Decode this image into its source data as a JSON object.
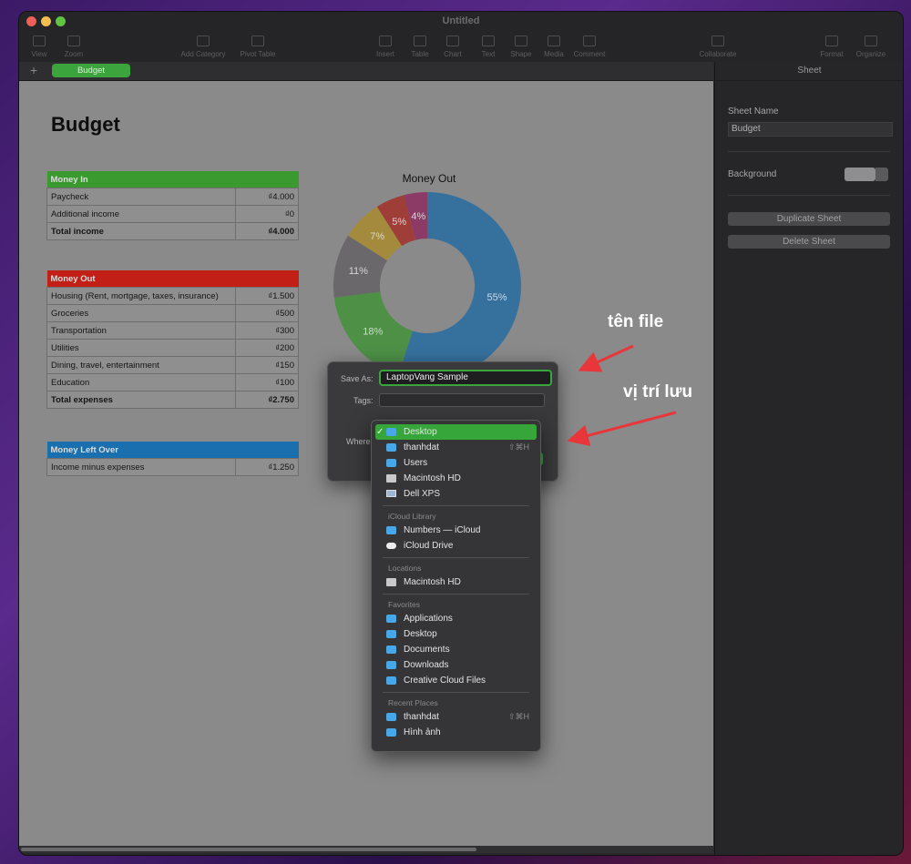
{
  "window": {
    "title": "Untitled",
    "toolbar": [
      "View",
      "Zoom",
      "Add Category",
      "Pivot Table",
      "Insert",
      "Table",
      "Chart",
      "Text",
      "Shape",
      "Media",
      "Comment",
      "Collaborate",
      "Format",
      "Organize"
    ]
  },
  "tabs": {
    "add": "+",
    "active": "Budget"
  },
  "sheet": {
    "title": "Budget"
  },
  "tables": {
    "money_in": {
      "header": "Money In",
      "color": "#3a9a2f",
      "rows": [
        [
          "Paycheck",
          "₫4.000"
        ],
        [
          "Additional income",
          "₫0"
        ]
      ],
      "total": [
        "Total income",
        "₫4.000"
      ]
    },
    "money_out": {
      "header": "Money Out",
      "color": "#c21f16",
      "rows": [
        [
          "Housing (Rent, mortgage, taxes, insurance)",
          "₫1.500"
        ],
        [
          "Groceries",
          "₫500"
        ],
        [
          "Transportation",
          "₫300"
        ],
        [
          "Utilities",
          "₫200"
        ],
        [
          "Dining, travel, entertainment",
          "₫150"
        ],
        [
          "Education",
          "₫100"
        ]
      ],
      "total": [
        "Total expenses",
        "₫2.750"
      ]
    },
    "left_over": {
      "header": "Money Left Over",
      "color": "#1a6fae",
      "rows": [
        [
          "Income minus expenses",
          "₫1.250"
        ]
      ]
    }
  },
  "chart_data": {
    "type": "pie",
    "title": "Money Out",
    "donut": true,
    "labels": [
      "55%",
      "18%",
      "11%",
      "7%",
      "5%",
      "4%"
    ],
    "values": [
      55,
      18,
      11,
      7,
      5,
      4
    ],
    "colors": [
      "#1668a6",
      "#36932c",
      "#5e5b60",
      "#ad8a1e",
      "#a8201a",
      "#8e1d59"
    ]
  },
  "inspector": {
    "title": "Sheet",
    "sheet_name_label": "Sheet Name",
    "sheet_name_value": "Budget",
    "background_label": "Background",
    "duplicate": "Duplicate Sheet",
    "delete": "Delete Sheet"
  },
  "dialog": {
    "save_as_label": "Save As:",
    "save_as_value": "LaptopVang Sample",
    "tags_label": "Tags:",
    "where_label": "Where"
  },
  "menu": {
    "top": [
      {
        "label": "Desktop",
        "icon": "folder-icon",
        "selected": true,
        "check": "✓"
      },
      {
        "label": "thanhdat",
        "icon": "folder-icon",
        "shortcut": "⇧⌘H"
      },
      {
        "label": "Users",
        "icon": "folder-icon"
      },
      {
        "label": "Macintosh HD",
        "icon": "hard-drive-icon"
      },
      {
        "label": "Dell XPS",
        "icon": "laptop-icon"
      }
    ],
    "icloud_header": "iCloud Library",
    "icloud": [
      {
        "label": "Numbers — iCloud",
        "icon": "folder-icon"
      },
      {
        "label": "iCloud Drive",
        "icon": "cloud-icon"
      }
    ],
    "locations_header": "Locations",
    "locations": [
      {
        "label": "Macintosh HD",
        "icon": "hard-drive-icon"
      }
    ],
    "favorites_header": "Favorites",
    "favorites": [
      {
        "label": "Applications",
        "icon": "folder-icon"
      },
      {
        "label": "Desktop",
        "icon": "folder-icon"
      },
      {
        "label": "Documents",
        "icon": "folder-icon"
      },
      {
        "label": "Downloads",
        "icon": "folder-icon"
      },
      {
        "label": "Creative Cloud Files",
        "icon": "folder-icon"
      }
    ],
    "recent_header": "Recent Places",
    "recent": [
      {
        "label": "thanhdat",
        "icon": "folder-icon",
        "shortcut": "⇧⌘H"
      },
      {
        "label": "Hình ảnh",
        "icon": "folder-icon"
      }
    ]
  },
  "annotations": {
    "file_name": "tên file",
    "save_location": "vị trí lưu",
    "arrow_color": "#e8363a"
  }
}
